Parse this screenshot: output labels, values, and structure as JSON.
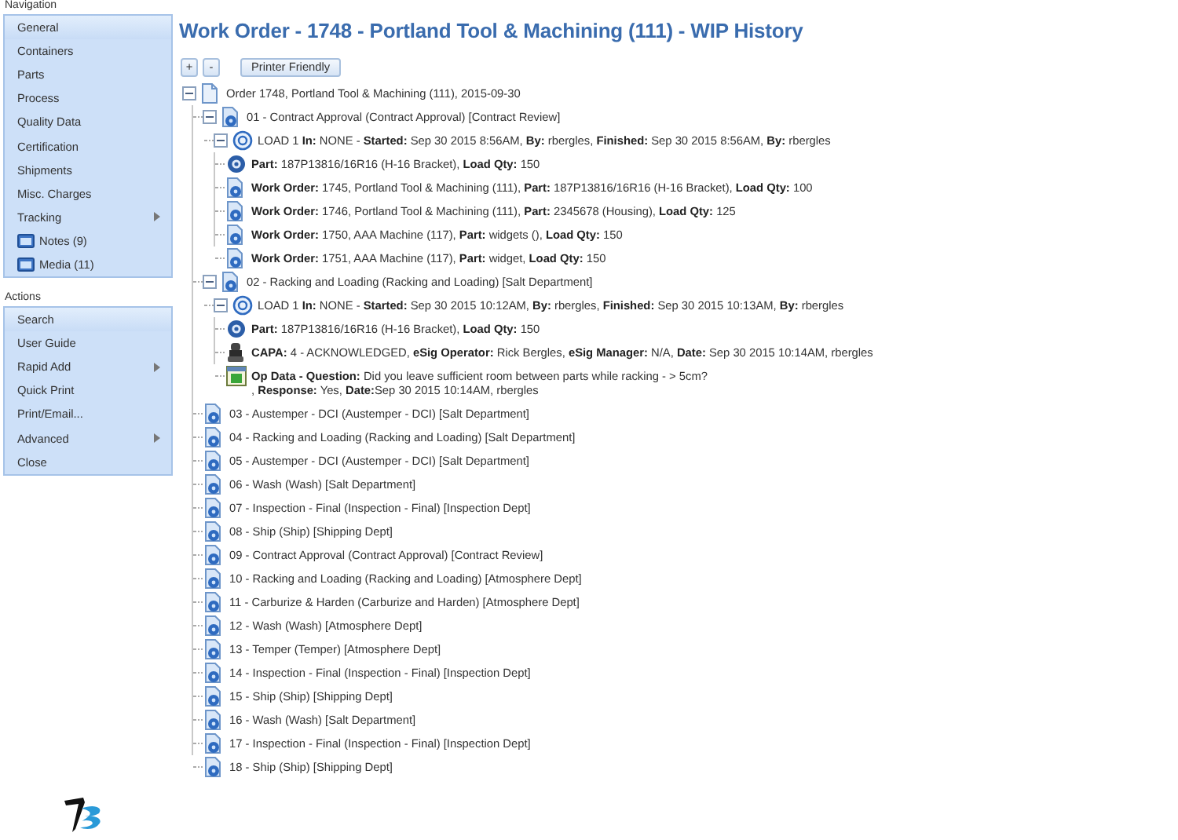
{
  "sidebar": {
    "navigation": {
      "label": "Navigation",
      "items": [
        {
          "label": "General",
          "kind": "text",
          "selected": true
        },
        {
          "label": "Containers",
          "kind": "text",
          "selected": false
        },
        {
          "label": "Parts",
          "kind": "text",
          "selected": false
        },
        {
          "label": "Process",
          "kind": "text",
          "selected": false
        },
        {
          "label": "Quality Data",
          "kind": "text",
          "selected": false
        },
        {
          "label": "Certification",
          "kind": "text",
          "selected": false
        },
        {
          "label": "Shipments",
          "kind": "text",
          "selected": false
        },
        {
          "label": "Misc. Charges",
          "kind": "text",
          "selected": false
        },
        {
          "label": "Tracking",
          "kind": "submenu",
          "selected": false
        },
        {
          "label": "Notes (9)",
          "kind": "attachment",
          "selected": false
        },
        {
          "label": "Media (11)",
          "kind": "attachment",
          "selected": false
        }
      ]
    },
    "actions": {
      "label": "Actions",
      "items": [
        {
          "label": "Search",
          "kind": "text",
          "selected": true
        },
        {
          "label": "User Guide",
          "kind": "text",
          "selected": false
        },
        {
          "label": "Rapid Add",
          "kind": "submenu",
          "selected": false
        },
        {
          "label": "Quick Print",
          "kind": "text",
          "selected": false
        },
        {
          "label": "Print/Email...",
          "kind": "text",
          "selected": false
        },
        {
          "label": "Advanced",
          "kind": "submenu",
          "selected": false
        },
        {
          "label": "Close",
          "kind": "text",
          "selected": false
        }
      ]
    }
  },
  "title": "Work Order - 1748 - Portland Tool & Machining (111) - WIP History",
  "toolbar": {
    "expand_all": "+",
    "collapse_all": "-",
    "printer_friendly": "Printer Friendly"
  },
  "tree": [
    {
      "kind": "order",
      "text": "Order 1748, Portland Tool & Machining (111), 2015-09-30",
      "expanded": true,
      "children": [
        {
          "kind": "operation",
          "text": "01 - Contract Approval (Contract Approval) [Contract Review]",
          "expanded": true,
          "children": [
            {
              "kind": "load",
              "text": "LOAD 1 **In:** NONE - **Started:** Sep 30 2015 8:56AM, **By:** rbergles, **Finished:** Sep 30 2015 8:56AM, **By:** rbergles",
              "expanded": true,
              "children": [
                {
                  "kind": "part",
                  "text": "**Part:** 187P13816/16R16 (H-16 Bracket), **Load Qty:** 150"
                },
                {
                  "kind": "work_order",
                  "text": "**Work Order:** 1745, Portland Tool & Machining (111), **Part:** 187P13816/16R16 (H-16 Bracket), **Load Qty:** 100"
                },
                {
                  "kind": "work_order",
                  "text": "**Work Order:** 1746, Portland Tool & Machining (111), **Part:** 2345678 (Housing), **Load Qty:** 125"
                },
                {
                  "kind": "work_order",
                  "text": "**Work Order:** 1750, AAA Machine (117), **Part:** widgets (), **Load Qty:** 150"
                },
                {
                  "kind": "work_order",
                  "text": "**Work Order:** 1751, AAA Machine (117), **Part:** widget, **Load Qty:** 150"
                }
              ]
            }
          ]
        },
        {
          "kind": "operation",
          "text": "02 - Racking and Loading (Racking and Loading) [Salt Department]",
          "expanded": true,
          "children": [
            {
              "kind": "load",
              "text": "LOAD 1 **In:** NONE - **Started:** Sep 30 2015 10:12AM, **By:** rbergles, **Finished:** Sep 30 2015 10:13AM, **By:** rbergles",
              "expanded": true,
              "children": [
                {
                  "kind": "part",
                  "text": "**Part:** 187P13816/16R16 (H-16 Bracket), **Load Qty:** 150"
                },
                {
                  "kind": "capa",
                  "text": "**CAPA:** 4 - ACKNOWLEDGED, **eSig Operator:** Rick Bergles, **eSig Manager:** N/A, **Date:** Sep 30 2015 10:14AM, rbergles"
                },
                {
                  "kind": "op_data",
                  "text": "**Op Data - Question:** Did you leave sufficient room between parts while racking - > 5cm?",
                  "continuation": ", **Response:** Yes, **Date:**Sep 30 2015 10:14AM, rbergles"
                }
              ]
            }
          ]
        },
        {
          "kind": "operation",
          "text": "03 - Austemper - DCI (Austemper - DCI) [Salt Department]"
        },
        {
          "kind": "operation",
          "text": "04 - Racking and Loading (Racking and Loading) [Salt Department]"
        },
        {
          "kind": "operation",
          "text": "05 - Austemper - DCI (Austemper - DCI) [Salt Department]"
        },
        {
          "kind": "operation",
          "text": "06 - Wash (Wash) [Salt Department]"
        },
        {
          "kind": "operation",
          "text": "07 - Inspection - Final (Inspection - Final) [Inspection Dept]"
        },
        {
          "kind": "operation",
          "text": "08 - Ship (Ship) [Shipping Dept]"
        },
        {
          "kind": "operation",
          "text": "09 - Contract Approval (Contract Approval) [Contract Review]"
        },
        {
          "kind": "operation",
          "text": "10 - Racking and Loading (Racking and Loading) [Atmosphere Dept]"
        },
        {
          "kind": "operation",
          "text": "11 - Carburize & Harden (Carburize and Harden) [Atmosphere Dept]"
        },
        {
          "kind": "operation",
          "text": "12 - Wash (Wash) [Atmosphere Dept]"
        },
        {
          "kind": "operation",
          "text": "13 - Temper (Temper) [Atmosphere Dept]"
        },
        {
          "kind": "operation",
          "text": "14 - Inspection - Final (Inspection - Final) [Inspection Dept]"
        },
        {
          "kind": "operation",
          "text": "15 - Ship (Ship) [Shipping Dept]"
        },
        {
          "kind": "operation",
          "text": "16 - Wash (Wash) [Salt Department]"
        },
        {
          "kind": "operation",
          "text": "17 - Inspection - Final (Inspection - Final) [Inspection Dept]"
        },
        {
          "kind": "operation",
          "text": "18 - Ship (Ship) [Shipping Dept]"
        }
      ]
    }
  ]
}
